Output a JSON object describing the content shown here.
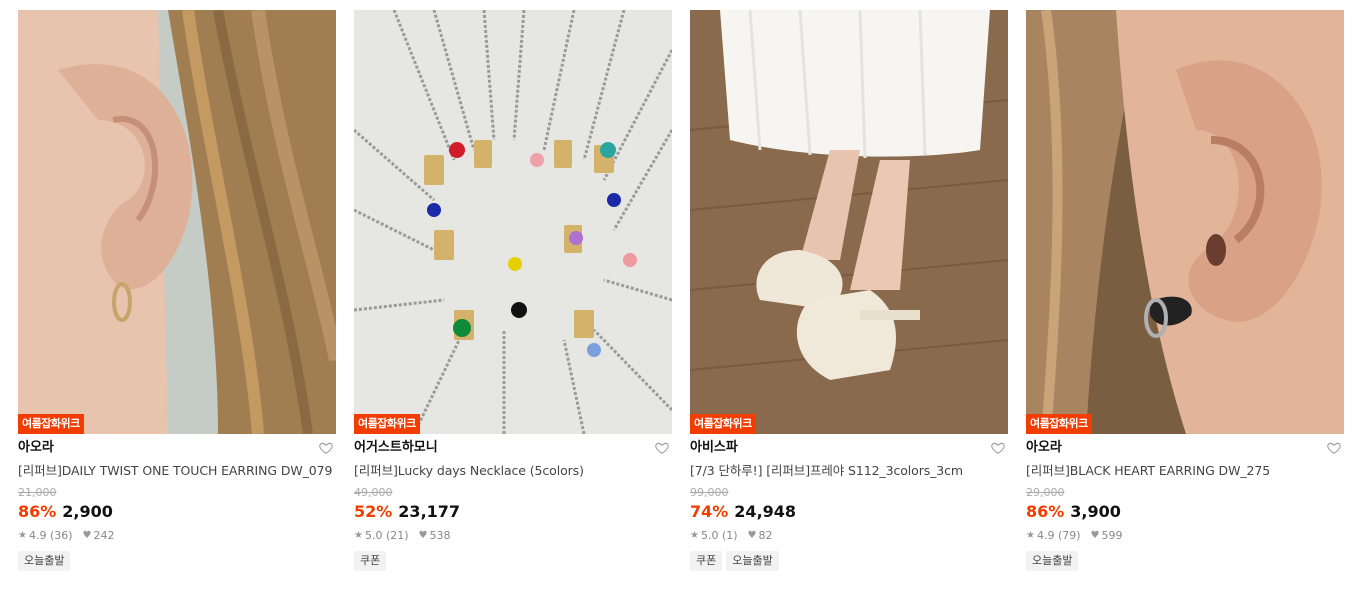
{
  "products": [
    {
      "badge": "여름잡화위크",
      "brand": "아오라",
      "title": "[리퍼브]DAILY TWIST ONE TOUCH EARRING DW_079",
      "original_price": "21,000",
      "discount": "86%",
      "price": "2,900",
      "rating": "4.9 (36)",
      "likes": "242",
      "tags": [
        "오늘출발"
      ],
      "image": "ear-gold-hoop-photo"
    },
    {
      "badge": "여름잡화위크",
      "brand": "어거스트하모니",
      "title": "[리퍼브]Lucky days Necklace (5colors)",
      "original_price": "49,000",
      "discount": "52%",
      "price": "23,177",
      "rating": "5.0 (21)",
      "likes": "538",
      "tags": [
        "쿠폰"
      ],
      "image": "necklaces-photo"
    },
    {
      "badge": "여름잡화위크",
      "brand": "아비스파",
      "title": "[7/3 단하루!] [리퍼브]프레야 S112_3colors_3cm",
      "original_price": "99,000",
      "discount": "74%",
      "price": "24,948",
      "rating": "5.0 (1)",
      "likes": "82",
      "tags": [
        "쿠폰",
        "오늘출발"
      ],
      "image": "sandals-photo"
    },
    {
      "badge": "여름잡화위크",
      "brand": "아오라",
      "title": "[리퍼브]BLACK HEART EARRING DW_275",
      "original_price": "29,000",
      "discount": "86%",
      "price": "3,900",
      "rating": "4.9 (79)",
      "likes": "599",
      "tags": [
        "오늘출발"
      ],
      "image": "ear-black-heart-photo"
    }
  ],
  "colors": {
    "accent": "#f23c00"
  }
}
